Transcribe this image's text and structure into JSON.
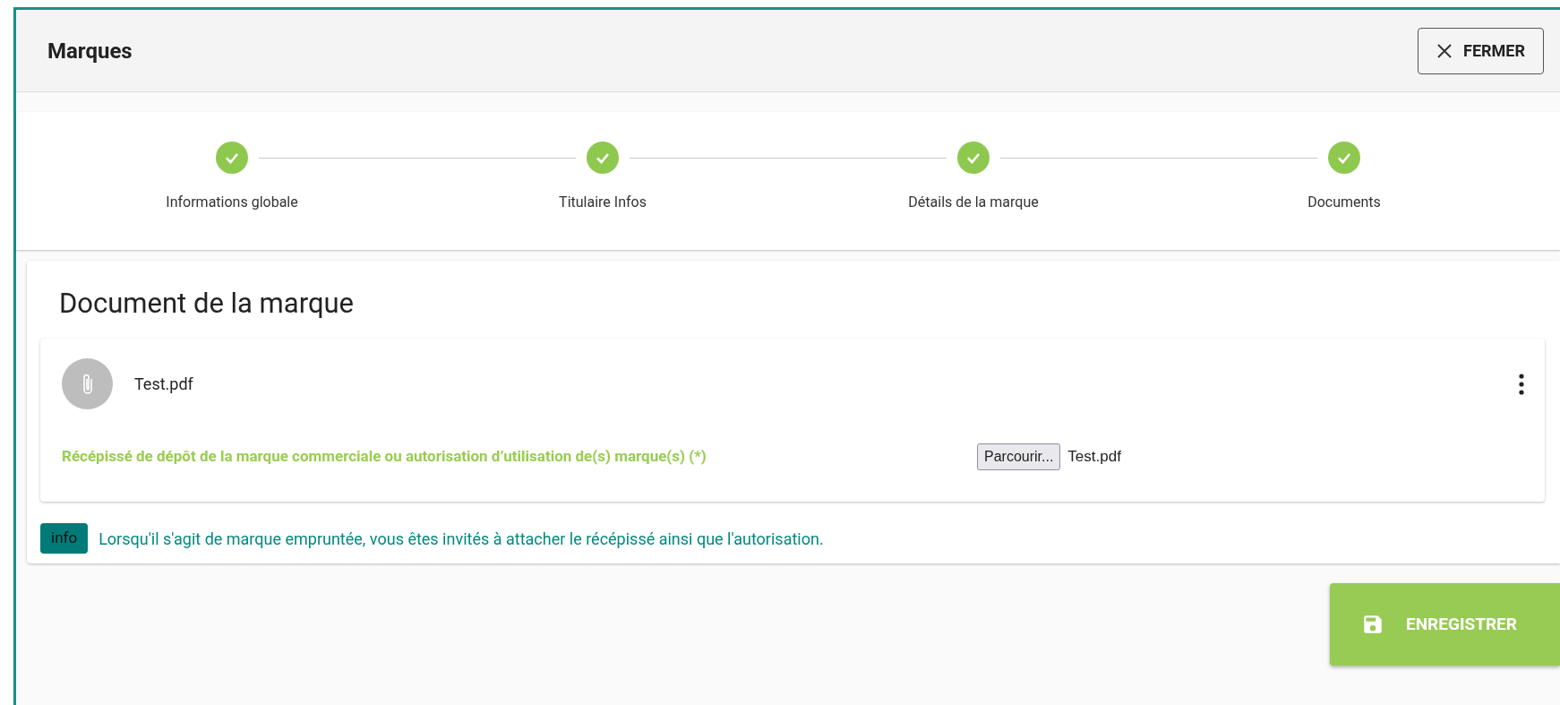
{
  "header": {
    "title": "Marques",
    "close_button": "FERMER"
  },
  "steps": [
    {
      "label": "Informations globale",
      "completed": true
    },
    {
      "label": "Titulaire Infos",
      "completed": true
    },
    {
      "label": "Détails de la marque",
      "completed": true
    },
    {
      "label": "Documents",
      "completed": true
    }
  ],
  "section": {
    "title": "Document de la marque",
    "document": {
      "file_name": "Test.pdf",
      "field_label": "Récépissé de dépôt de la marque commerciale ou autorisation d’utilisation de(s) marque(s) (*)",
      "browse_button": "Parcourir...",
      "chosen_file": "Test.pdf"
    },
    "info": {
      "badge": "info",
      "text": "Lorsqu'il s'agit de marque empruntée, vous êtes invités à attacher le récépissé ainsi que l'autorisation."
    }
  },
  "save_button": "ENREGISTRER"
}
